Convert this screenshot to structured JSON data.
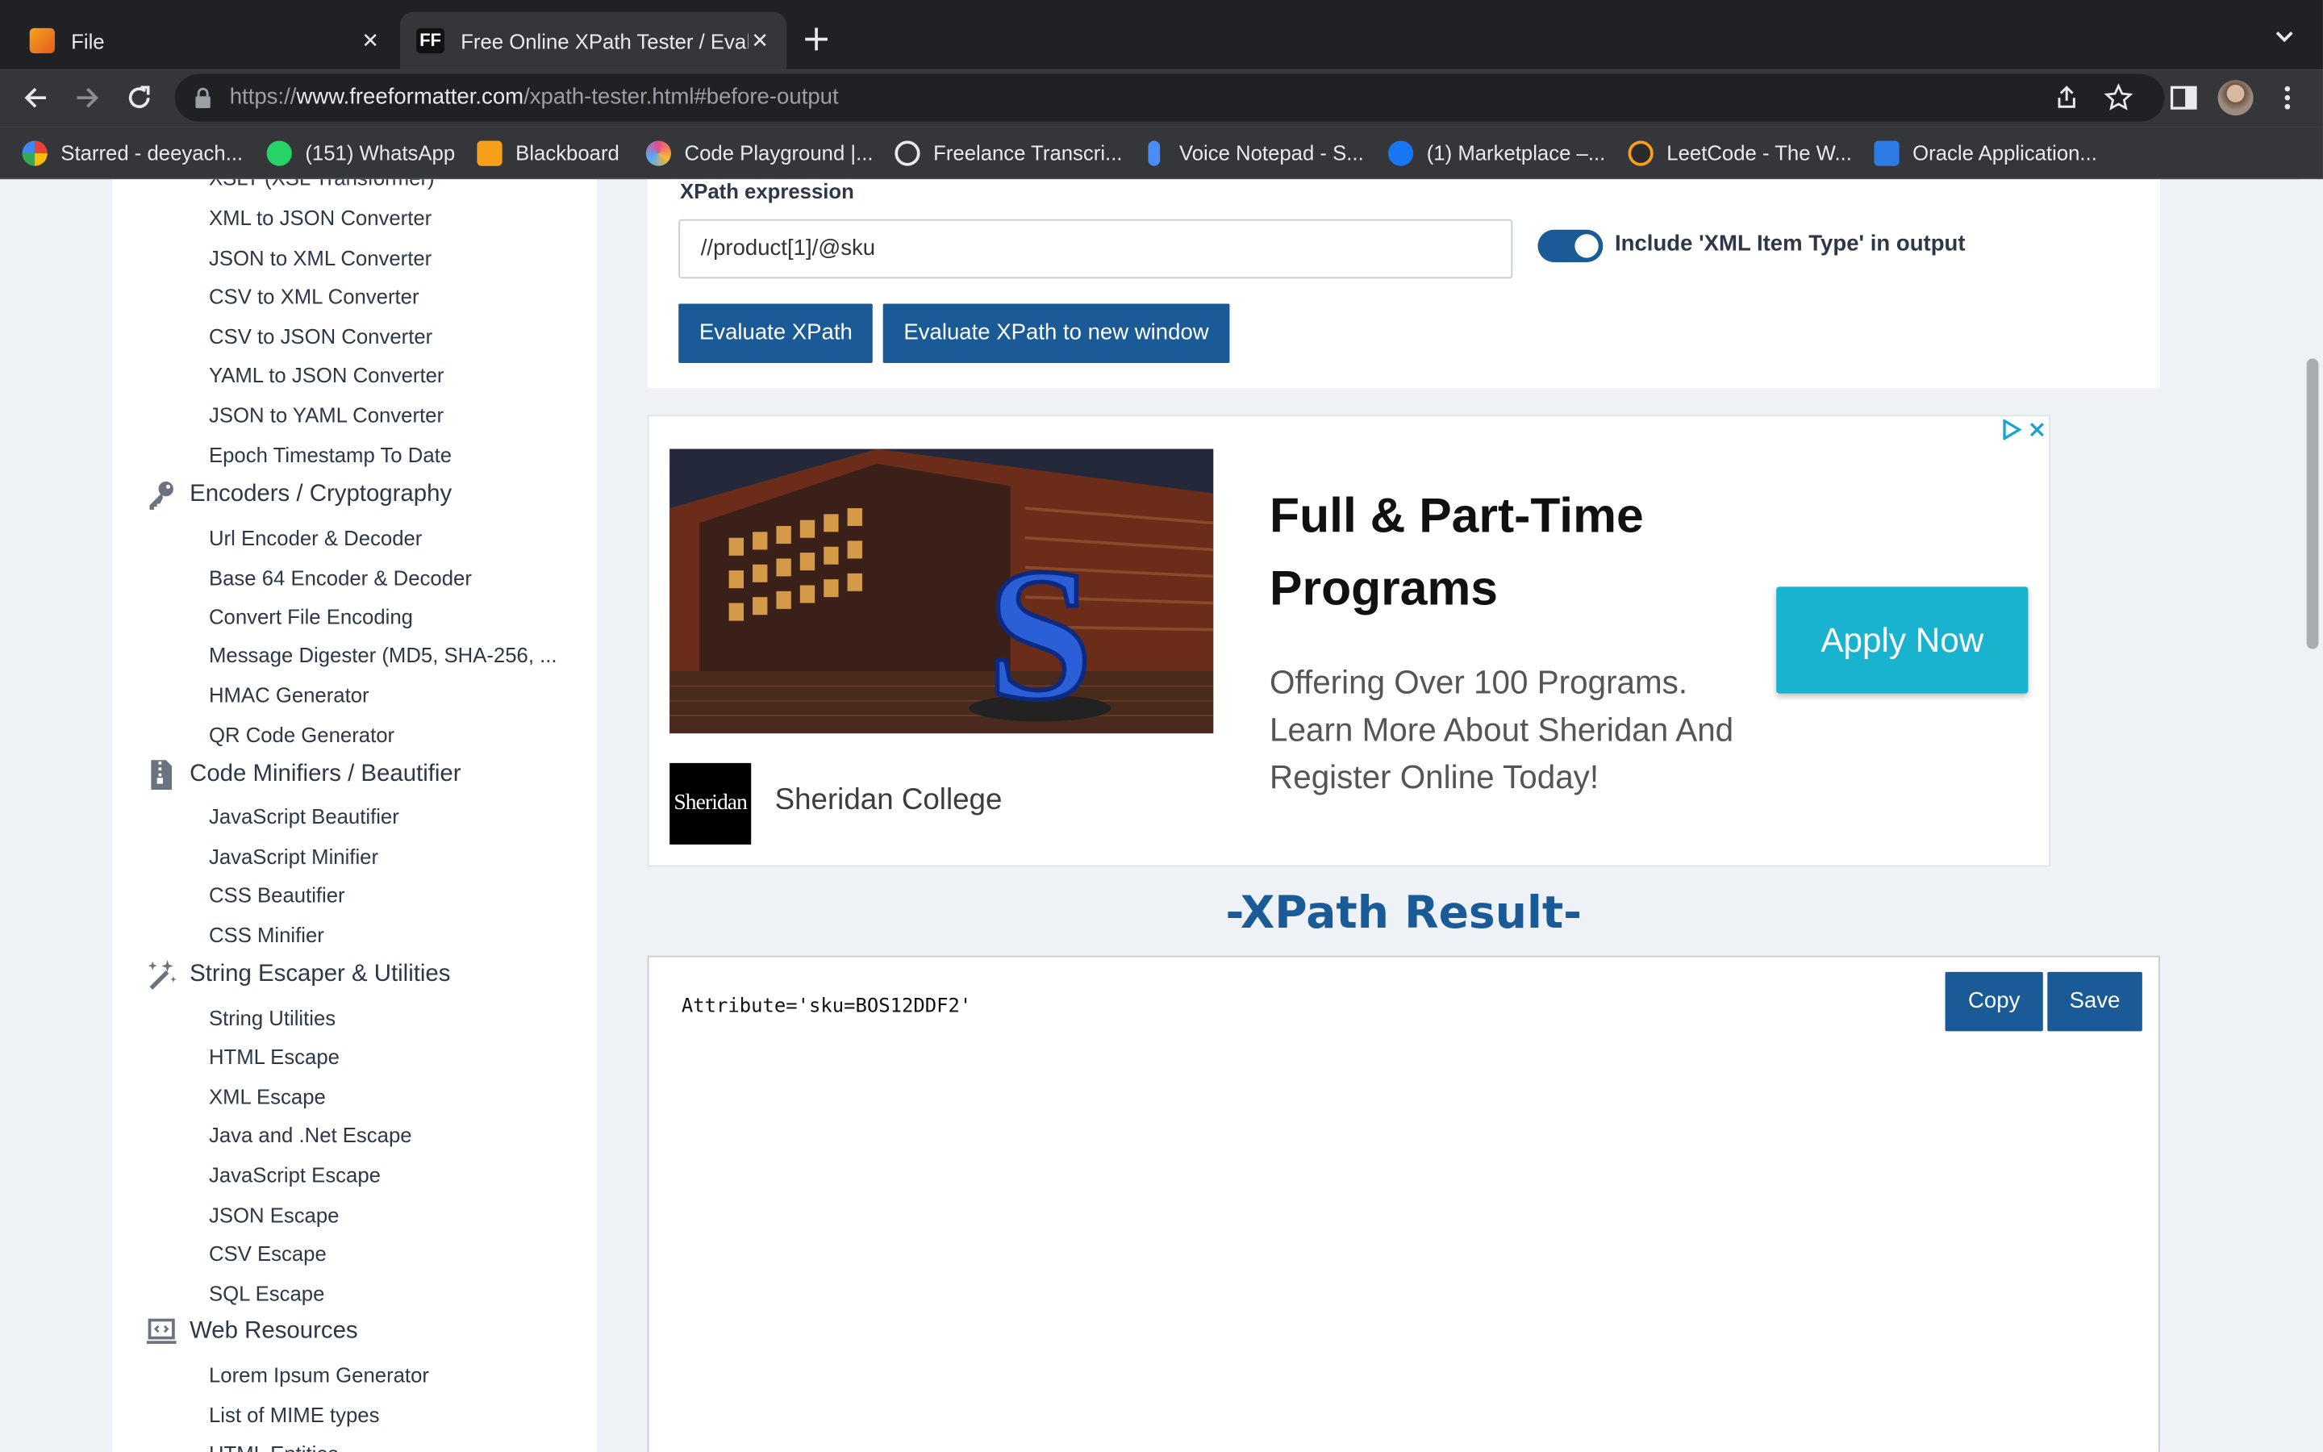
{
  "browser": {
    "tabs": [
      {
        "title": "File",
        "favicon": "notes-icon",
        "active": false
      },
      {
        "title": "Free Online XPath Tester / Evaluator",
        "favicon_text": "FF",
        "active": true
      }
    ],
    "address": {
      "scheme": "https://",
      "host": "www.freeformatter.com",
      "path": "/xpath-tester.html#before-output"
    },
    "bookmarks": [
      {
        "label": "Starred - deeyach...",
        "color": "#4285f4"
      },
      {
        "label": "(151) WhatsApp",
        "color": "#25d366"
      },
      {
        "label": "Blackboard",
        "color": "#f59f1a"
      },
      {
        "label": "Code Playground |...",
        "color": "#e64a8a"
      },
      {
        "label": "Freelance Transcri...",
        "color": "#e8eaed"
      },
      {
        "label": "Voice Notepad - S...",
        "color": "#4b8df8"
      },
      {
        "label": "(1) Marketplace –...",
        "color": "#1877f2"
      },
      {
        "label": "LeetCode - The W...",
        "color": "#f89f1b"
      },
      {
        "label": "Oracle Application...",
        "color": "#2d7be5"
      }
    ]
  },
  "sidebar": {
    "items_top": [
      "XSLT (XSL Transformer)",
      "XML to JSON Converter",
      "JSON to XML Converter",
      "CSV to XML Converter",
      "CSV to JSON Converter",
      "YAML to JSON Converter",
      "JSON to YAML Converter",
      "Epoch Timestamp To Date"
    ],
    "sections": [
      {
        "heading": "Encoders / Cryptography",
        "icon": "key-icon",
        "items": [
          "Url Encoder & Decoder",
          "Base 64 Encoder & Decoder",
          "Convert File Encoding",
          "Message Digester (MD5, SHA-256, ...",
          "HMAC Generator",
          "QR Code Generator"
        ]
      },
      {
        "heading": "Code Minifiers / Beautifier",
        "icon": "zip-file-icon",
        "items": [
          "JavaScript Beautifier",
          "JavaScript Minifier",
          "CSS Beautifier",
          "CSS Minifier"
        ]
      },
      {
        "heading": "String Escaper & Utilities",
        "icon": "magic-wand-icon",
        "items": [
          "String Utilities",
          "HTML Escape",
          "XML Escape",
          "Java and .Net Escape",
          "JavaScript Escape",
          "JSON Escape",
          "CSV Escape",
          "SQL Escape"
        ]
      },
      {
        "heading": "Web Resources",
        "icon": "laptop-code-icon",
        "items": [
          "Lorem Ipsum Generator",
          "List of MIME types",
          "HTML Entities"
        ]
      }
    ]
  },
  "form": {
    "label": "XPath expression",
    "expression": "//product[1]/@sku",
    "toggle_label": "Include 'XML Item Type' in output",
    "toggle_on": true,
    "evaluate_label": "Evaluate XPath",
    "evaluate_new_label": "Evaluate XPath to new window"
  },
  "ad": {
    "headline": "Full & Part-Time Programs",
    "body": "Offering Over 100 Programs. Learn More About Sheridan And Register Online Today!",
    "logo_text": "Sheridan",
    "brand": "Sheridan College",
    "cta": "Apply Now"
  },
  "result": {
    "title": "-XPath Result-",
    "output": "Attribute='sku=BOS12DDF2'",
    "copy_label": "Copy",
    "save_label": "Save"
  },
  "colors": {
    "primary": "#1a5a96",
    "ad_cta": "#1ab3cf",
    "chrome_dark": "#202124",
    "chrome_toolbar": "#35363a"
  }
}
